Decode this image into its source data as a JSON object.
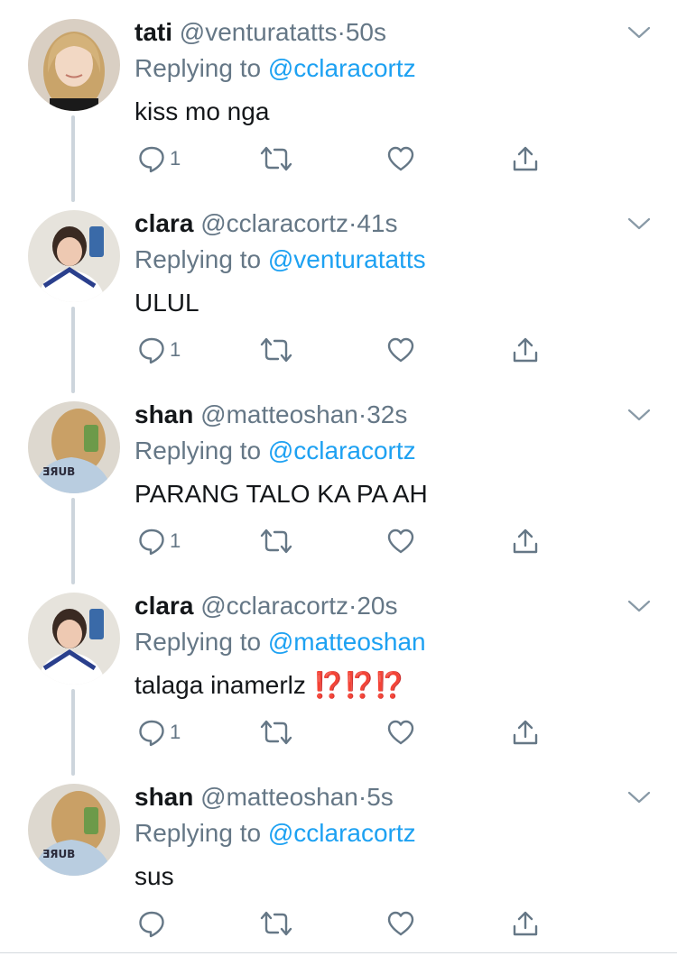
{
  "reply_prefix": "Replying to",
  "colors": {
    "accent": "#1da1f2",
    "secondary_text": "#657786",
    "primary_text": "#14171a",
    "thread_line": "#cdd5dc",
    "emoji_red": "#e0142b"
  },
  "tweets": [
    {
      "name": "tati",
      "handle": "@venturatatts",
      "separator": "·",
      "time": "50s",
      "replying_to": "@cclaracortz",
      "text": "kiss mo nga",
      "reply_count": "1",
      "avatar": "avatar-tati"
    },
    {
      "name": "clara",
      "handle": "@cclaracortz",
      "separator": "·",
      "time": "41s",
      "replying_to": "@venturatatts",
      "text": "ULUL",
      "reply_count": "1",
      "avatar": "avatar-clara"
    },
    {
      "name": "shan",
      "handle": "@matteoshan",
      "separator": "·",
      "time": "32s",
      "replying_to": "@cclaracortz",
      "text": "PARANG TALO KA PA AH",
      "reply_count": "1",
      "avatar": "avatar-shan"
    },
    {
      "name": "clara",
      "handle": "@cclaracortz",
      "separator": "·",
      "time": "20s",
      "replying_to": "@matteoshan",
      "text": "talaga inamerlz",
      "emoji": "⁉️⁉️⁉️",
      "reply_count": "1",
      "avatar": "avatar-clara"
    },
    {
      "name": "shan",
      "handle": "@matteoshan",
      "separator": "·",
      "time": "5s",
      "replying_to": "@cclaracortz",
      "text": "sus",
      "reply_count": "",
      "avatar": "avatar-shan"
    }
  ]
}
